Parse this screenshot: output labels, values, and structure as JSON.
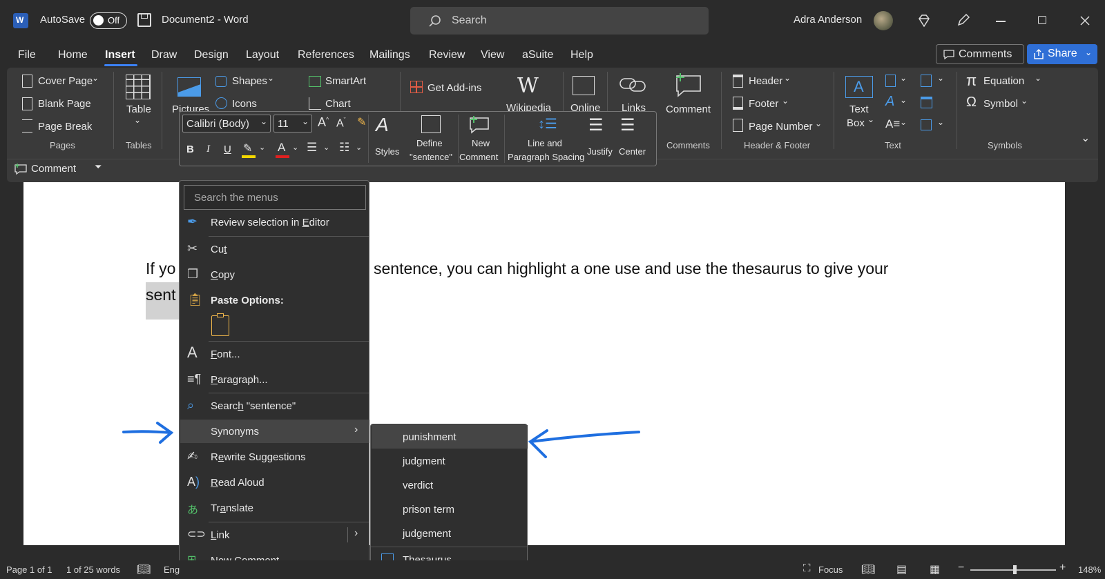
{
  "titlebar": {
    "autosave_label": "AutoSave",
    "autosave_state": "Off",
    "doc_title": "Document2  -  Word",
    "search_placeholder": "Search",
    "user_name": "Adra Anderson"
  },
  "tabs": [
    "File",
    "Home",
    "Insert",
    "Draw",
    "Design",
    "Layout",
    "References",
    "Mailings",
    "Review",
    "View",
    "aSuite",
    "Help"
  ],
  "active_tab": "Insert",
  "comments_button": "Comments",
  "share_button": "Share",
  "ribbon": {
    "pages": {
      "cover_page": "Cover Page",
      "blank_page": "Blank Page",
      "page_break": "Page Break",
      "group": "Pages"
    },
    "tables": {
      "table": "Table",
      "group": "Tables"
    },
    "illustrations": {
      "pictures": "Pictures",
      "shapes": "Shapes",
      "icons": "Icons",
      "smartart": "SmartArt",
      "chart": "Chart"
    },
    "addins": {
      "get_addins": "Get Add-ins",
      "wikipedia": "Wikipedia",
      "online": "Online"
    },
    "links": {
      "links": "Links"
    },
    "comments": {
      "comment": "Comment",
      "group": "Comments"
    },
    "header_footer": {
      "header": "Header",
      "footer": "Footer",
      "page_number": "Page Number",
      "group": "Header & Footer"
    },
    "text": {
      "text_box_1": "Text",
      "text_box_2": "Box",
      "group": "Text"
    },
    "symbols": {
      "equation": "Equation",
      "symbol": "Symbol",
      "group": "Symbols"
    },
    "quick_comment": "Comment"
  },
  "minibar": {
    "font": "Calibri (Body)",
    "size": "11",
    "styles": "Styles",
    "define_1": "Define",
    "define_2": "\"sentence\"",
    "new_comment_1": "New",
    "new_comment_2": "Comment",
    "line_spacing_1": "Line and",
    "line_spacing_2": "Paragraph Spacing",
    "justify": "Justify",
    "center": "Center"
  },
  "document": {
    "line1_start": "If yo",
    "line1_end": "sentence, you can highlight a one use and use the thesaurus to give your",
    "line2_start": "sent"
  },
  "context_menu": {
    "search_placeholder": "Search the menus",
    "review_selection": "Review selection in Editor",
    "cut": "Cut",
    "copy": "Copy",
    "paste_options": "Paste Options:",
    "font": "Font...",
    "paragraph": "Paragraph...",
    "search": "Search \"sentence\"",
    "synonyms": "Synonyms",
    "rewrite": "Rewrite Suggestions",
    "read_aloud": "Read Aloud",
    "translate": "Translate",
    "link": "Link",
    "new_comment": "New Comment"
  },
  "synonyms": [
    "punishment",
    "judgment",
    "verdict",
    "prison term",
    "judgement"
  ],
  "thesaurus": "Thesaurus...",
  "status": {
    "page": "Page 1 of 1",
    "words": "1 of 25 words",
    "lang": "Eng",
    "focus": "Focus",
    "zoom": "148%"
  },
  "colors": {
    "accent": "#3b82f6",
    "annotation_arrow": "#1f6fe0",
    "highlight_yellow": "#f5d800",
    "font_red": "#e02020"
  }
}
